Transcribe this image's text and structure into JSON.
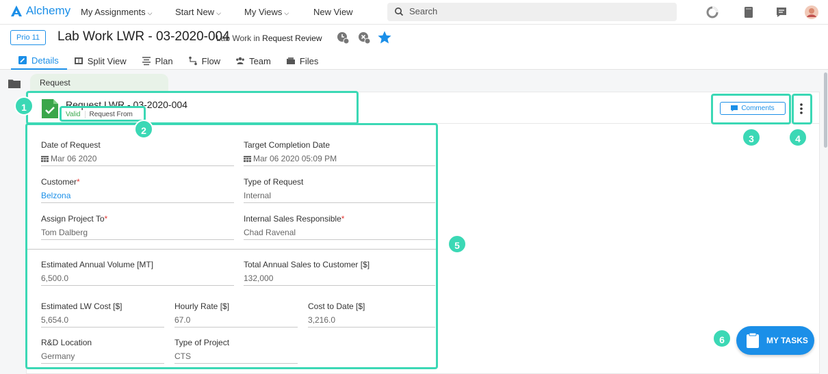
{
  "app": {
    "name": "Alchemy",
    "brand_color": "#1b8fe8",
    "annotation_color": "#3bd8b5"
  },
  "topnav": {
    "items": [
      {
        "label": "My Assignments",
        "caret": true
      },
      {
        "label": "Start New",
        "caret": true
      },
      {
        "label": "My Views",
        "caret": true
      },
      {
        "label": "New View",
        "caret": false
      }
    ],
    "search_placeholder": "Search",
    "icons": [
      "loading-icon",
      "notebook-icon",
      "chat-icon",
      "avatar"
    ]
  },
  "header": {
    "priority": "Prio 11",
    "title": "Lab Work LWR - 03-2020-004",
    "subtitle_prefix": "Lab Work in",
    "subtitle_status": "Request Review",
    "icons": [
      "clock-icon",
      "cancel-icon",
      "star-icon"
    ],
    "tabs": [
      {
        "label": "Details",
        "icon": "details-icon",
        "active": true
      },
      {
        "label": "Split View",
        "icon": "split-view-icon",
        "active": false
      },
      {
        "label": "Plan",
        "icon": "plan-icon",
        "active": false
      },
      {
        "label": "Flow",
        "icon": "flow-icon",
        "active": false
      },
      {
        "label": "Team",
        "icon": "team-icon",
        "active": false
      },
      {
        "label": "Files",
        "icon": "files-icon",
        "active": false
      }
    ]
  },
  "breadcrumb": {
    "label": "Request"
  },
  "record": {
    "title": "Request LWR - 03-2020-004",
    "status": "Valid",
    "type": "Request From",
    "comments_label": "Comments"
  },
  "form": {
    "date_of_request": {
      "label": "Date of Request",
      "value": "Mar 06 2020"
    },
    "target_completion_date": {
      "label": "Target Completion Date",
      "value": "Mar 06 2020 05:09 PM"
    },
    "customer": {
      "label": "Customer",
      "required": "*",
      "value": "Belzona"
    },
    "type_of_request": {
      "label": "Type of Request",
      "value": "Internal"
    },
    "assign_project_to": {
      "label": "Assign Project To",
      "required": "*",
      "value": "Tom Dalberg"
    },
    "internal_sales_responsible": {
      "label": "Internal Sales Responsible",
      "required": "*",
      "value": "Chad Ravenal"
    },
    "estimated_annual_volume": {
      "label": "Estimated Annual Volume [MT]",
      "value": "6,500.0"
    },
    "total_annual_sales": {
      "label": "Total Annual Sales to Customer [$]",
      "value": "132,000"
    },
    "estimated_lw_cost": {
      "label": "Estimated LW Cost [$]",
      "value": "5,654.0"
    },
    "hourly_rate": {
      "label": "Hourly Rate [$]",
      "value": "67.0"
    },
    "cost_to_date": {
      "label": "Cost to Date [$]",
      "value": "3,216.0"
    },
    "rd_location": {
      "label": "R&D Location",
      "value": "Germany"
    },
    "type_of_project": {
      "label": "Type of Project",
      "value": "CTS"
    }
  },
  "annotations": [
    "1",
    "2",
    "3",
    "4",
    "5",
    "6"
  ],
  "my_tasks": {
    "label": "MY TASKS"
  }
}
